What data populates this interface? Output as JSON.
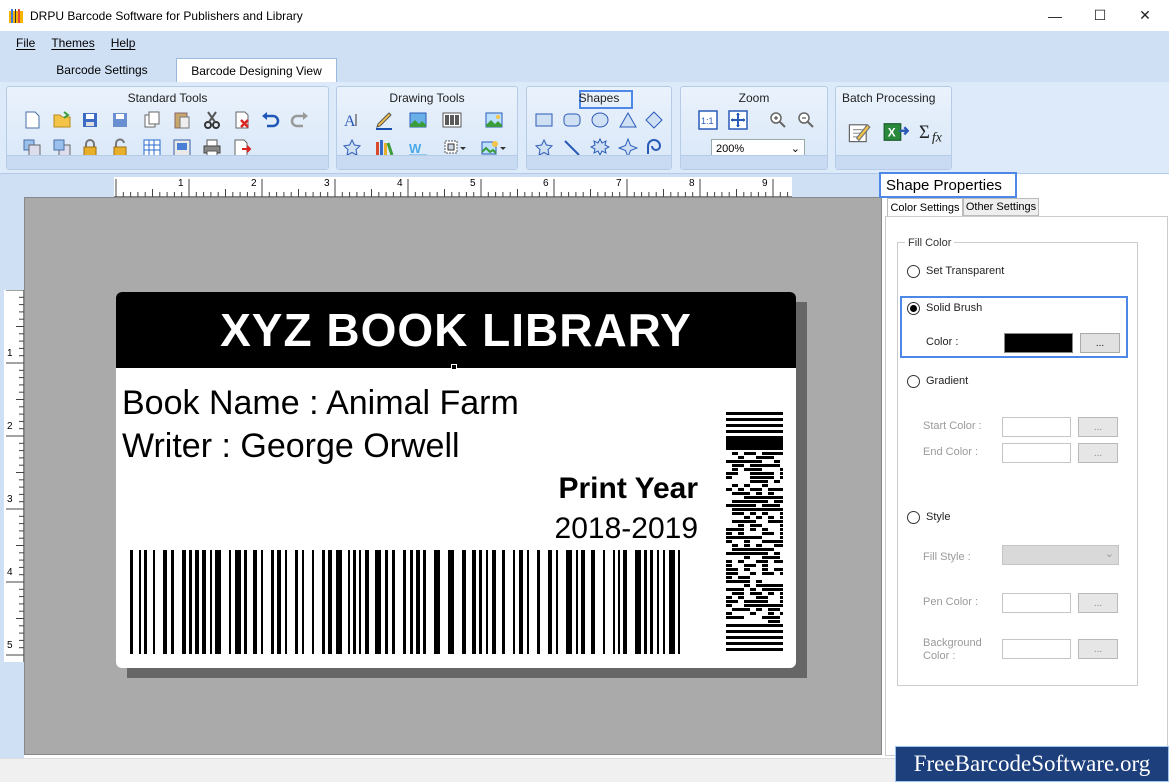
{
  "window": {
    "title": "DRPU Barcode Software for Publishers and Library",
    "minimize": "—",
    "maximize": "☐",
    "close": "✕"
  },
  "menu": [
    "File",
    "Themes",
    "Help"
  ],
  "tabs": {
    "barcode_settings": "Barcode Settings",
    "barcode_designing_view": "Barcode Designing View"
  },
  "ribbon": {
    "standard_tools": "Standard Tools",
    "drawing_tools": "Drawing Tools",
    "shapes": "Shapes",
    "zoom": "Zoom",
    "zoom_value": "200%",
    "batch_processing": "Batch Processing"
  },
  "ruler": {
    "h": [
      "1",
      "2",
      "3",
      "4",
      "5",
      "6",
      "7",
      "8",
      "9"
    ],
    "v": [
      "1",
      "2",
      "3",
      "4",
      "5"
    ]
  },
  "label": {
    "header": "XYZ BOOK LIBRARY",
    "book_name": "Book Name : Animal Farm",
    "writer": "Writer : George Orwell",
    "print_year_label": "Print Year",
    "print_year": "2018-2019"
  },
  "panel": {
    "title": "Shape Properties",
    "tab_color": "Color Settings",
    "tab_other": "Other Settings",
    "fill_color": "Fill Color",
    "set_transparent": "Set Transparent",
    "solid_brush": "Solid Brush",
    "color_label": "Color :",
    "color_value": "#000000",
    "gradient": "Gradient",
    "start_color": "Start Color :",
    "end_color": "End Color :",
    "style": "Style",
    "fill_style": "Fill Style :",
    "pen_color": "Pen Color :",
    "background_color": "Background Color :",
    "ellipsis": "..."
  },
  "watermark": "FreeBarcodeSoftware.org",
  "colors": {
    "accent": "#4e88e6",
    "ribbon": "#ddeafa",
    "menu": "#cfe0f5"
  }
}
